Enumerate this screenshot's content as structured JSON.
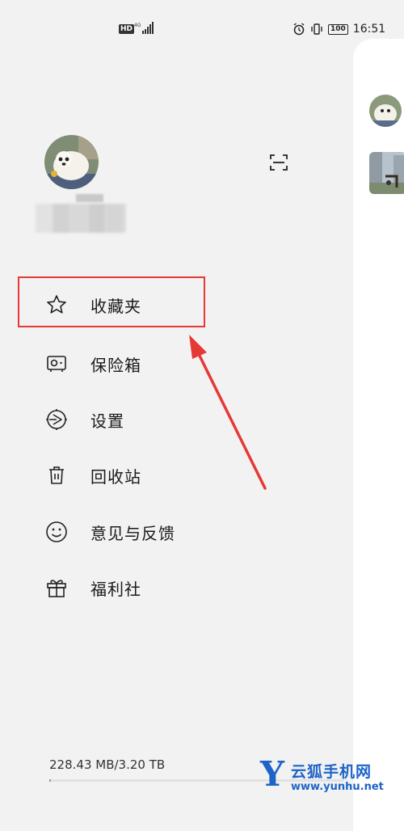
{
  "status_bar": {
    "hd": "HD",
    "net": "4G",
    "battery": "100",
    "time": "16:51"
  },
  "menu": [
    {
      "label": "收藏夹",
      "icon": "star-icon"
    },
    {
      "label": "保险箱",
      "icon": "safe-icon"
    },
    {
      "label": "设置",
      "icon": "settings-icon"
    },
    {
      "label": "回收站",
      "icon": "trash-icon"
    },
    {
      "label": "意见与反馈",
      "icon": "smile-icon"
    },
    {
      "label": "福利社",
      "icon": "gift-icon"
    }
  ],
  "storage": {
    "text": "228.43 MB/3.20 TB",
    "used_fraction": 0.0001
  },
  "watermark": {
    "logo": "Y",
    "name": "云狐手机网",
    "url": "www.yunhu.net"
  },
  "colors": {
    "background": "#f2f2f2",
    "highlight": "#e53935",
    "watermark": "#1e64c8"
  }
}
